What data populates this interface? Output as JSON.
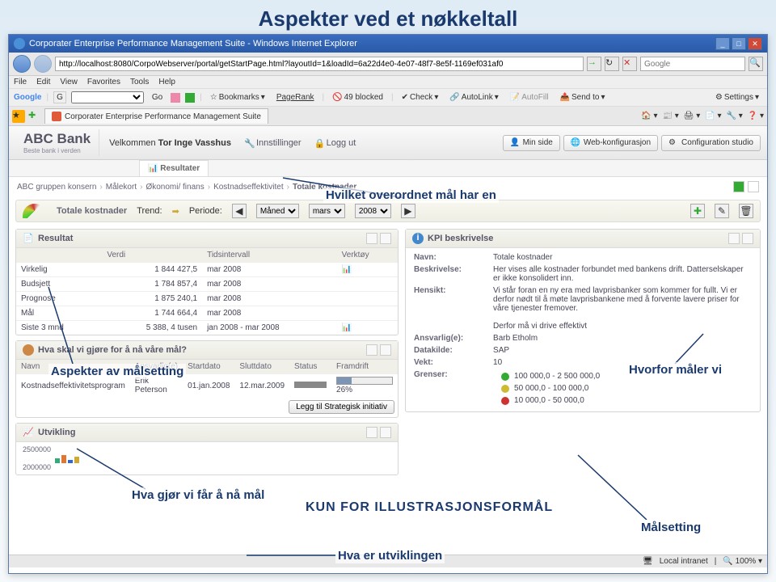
{
  "slide_title": "Aspekter ved et nøkkeltall",
  "window_title": "Corporater Enterprise Performance Management Suite - Windows Internet Explorer",
  "url": "http://localhost:8080/CorpoWebserver/portal/getStartPage.html?layoutId=1&loadId=6a22d4e0-4e07-48f7-8e5f-1169ef031af0",
  "search_placeholder": "Google",
  "menu": {
    "file": "File",
    "edit": "Edit",
    "view": "View",
    "favorites": "Favorites",
    "tools": "Tools",
    "help": "Help"
  },
  "google_toolbar": {
    "brand": "Google",
    "g": "G",
    "go": "Go",
    "bookmarks": "Bookmarks",
    "pagerank": "PageRank",
    "blocked": "49 blocked",
    "check": "Check",
    "autolink": "AutoLink",
    "autofill": "AutoFill",
    "sendto": "Send to",
    "settings": "Settings"
  },
  "tab_title": "Corporater Enterprise Performance Management Suite",
  "app": {
    "bank_name": "ABC Bank",
    "bank_slogan": "Beste bank i verden",
    "welcome": "Velkommen",
    "user": "Tor Inge Vasshus",
    "settings": "Innstillinger",
    "logout": "Logg ut",
    "buttons": {
      "minside": "Min side",
      "webconfig": "Web-konfigurasjon",
      "configstudio": "Configuration studio"
    },
    "results_tab": "Resultater"
  },
  "breadcrumb": {
    "a": "ABC gruppen konsern",
    "b": "Målekort",
    "c": "Økonomi/ finans",
    "d": "Kostnadseffektivitet",
    "e": "Totale kostnader"
  },
  "kpibar": {
    "title": "Totale kostnader",
    "trend": "Trend:",
    "periode": "Periode:",
    "interval": "Måned",
    "month": "mars",
    "year": "2008"
  },
  "resultat": {
    "title": "Resultat",
    "headers": {
      "name": "",
      "verdi": "Verdi",
      "tid": "Tidsintervall",
      "verktoy": "Verktøy"
    },
    "rows": [
      {
        "name": "Virkelig",
        "verdi": "1 844 427,5",
        "tid": "mar 2008"
      },
      {
        "name": "Budsjett",
        "verdi": "1 784 857,4",
        "tid": "mar 2008"
      },
      {
        "name": "Prognose",
        "verdi": "1 875 240,1",
        "tid": "mar 2008"
      },
      {
        "name": "Mål",
        "verdi": "1 744 664,4",
        "tid": "mar 2008"
      },
      {
        "name": "Siste 3 mnd",
        "verdi": "5 388, 4 tusen",
        "tid": "jan 2008 - mar 2008"
      }
    ]
  },
  "goals": {
    "title": "Hva skal vi gjøre for å nå våre mål?",
    "headers": {
      "navn": "Navn",
      "ansvarlig": "Ansvarlig(e)",
      "start": "Startdato",
      "slutt": "Sluttdato",
      "status": "Status",
      "framdrift": "Framdrift"
    },
    "row": {
      "navn": "Kostnadseffektivitetsprogram",
      "ansvarlig": "Erik Peterson",
      "start": "01.jan.2008",
      "slutt": "12.mar.2009",
      "pct": "26%"
    },
    "add_btn": "Legg til Strategisk initiativ"
  },
  "kpi": {
    "title": "KPI beskrivelse",
    "navn_l": "Navn:",
    "navn": "Totale kostnader",
    "beskrivelse_l": "Beskrivelse:",
    "beskrivelse": "Her vises alle kostnader forbundet med bankens drift. Datterselskaper er ikke konsolidert inn.",
    "hensikt_l": "Hensikt:",
    "hensikt": "Vi står foran en ny era med lavprisbanker som kommer for fullt. Vi er derfor nødt til å møte lavprisbankene med å forvente lavere priser for våre tjenester fremover.",
    "hensikt2": "Derfor må vi drive effektivt",
    "ansvarlig_l": "Ansvarlig(e):",
    "ansvarlig": "Barb Etholm",
    "datakilde_l": "Datakilde:",
    "datakilde": "SAP",
    "vekt_l": "Vekt:",
    "vekt": "10",
    "grenser_l": "Grenser:",
    "grenser": {
      "g": "100 000,0 - 2 500 000,0",
      "y": "50 000,0 - 100 000,0",
      "r": "10 000,0 - 50 000,0"
    }
  },
  "utvikling": {
    "title": "Utvikling",
    "y1": "2500000",
    "y2": "2000000"
  },
  "annotations": {
    "a1": "Hvilket overordnet mål har en",
    "a2": "Aspekter av målsetting",
    "a3": "Hvorfor måler vi",
    "a4": "Hva gjør vi får å nå mål",
    "a5": "KUN FOR ILLUSTRASJONSFORMÅL",
    "a6": "Målsetting",
    "a7": "Hva er utviklingen"
  },
  "status": {
    "intranet": "Local intranet",
    "zoom": "100%"
  }
}
